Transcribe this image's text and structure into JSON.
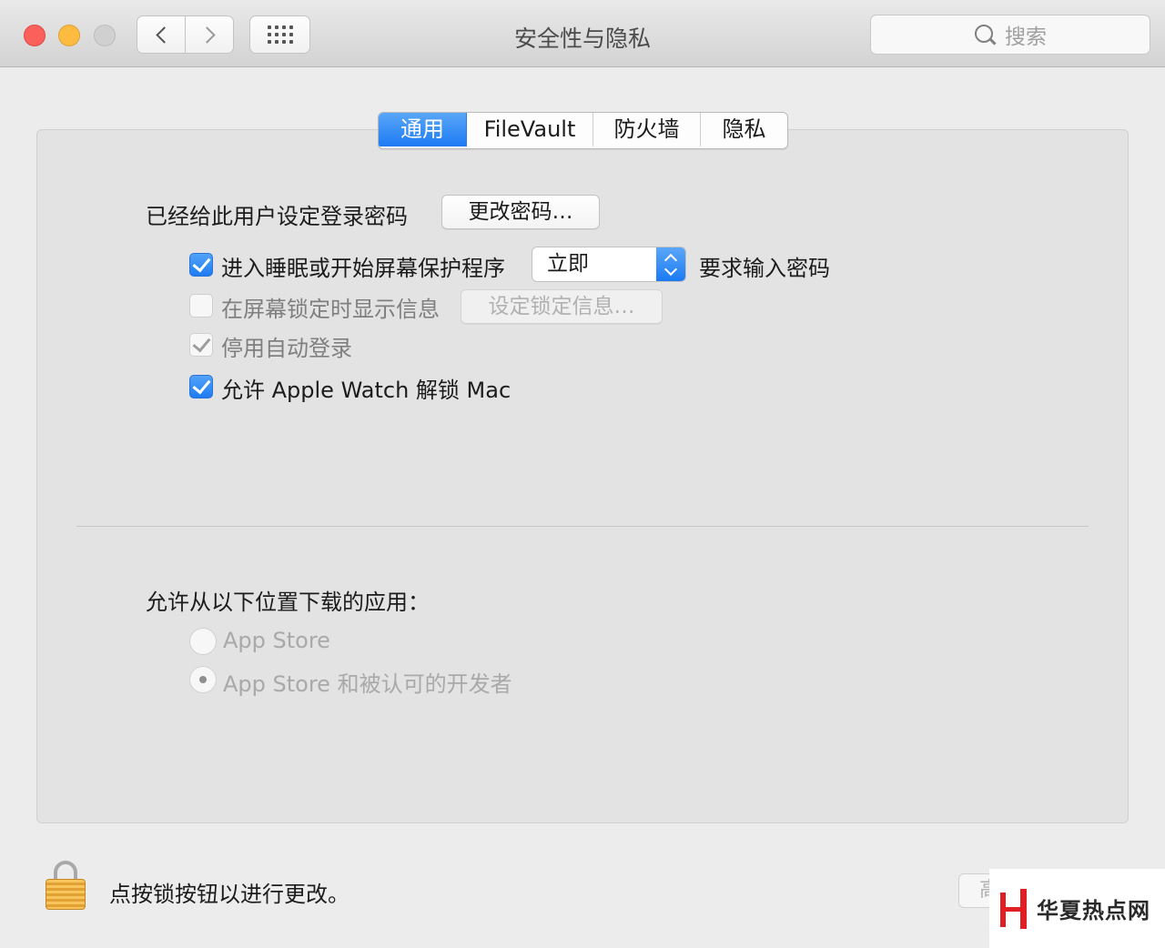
{
  "window": {
    "title": "安全性与隐私"
  },
  "toolbar": {
    "search_placeholder": "搜索"
  },
  "tabs": [
    {
      "label": "通用",
      "active": true
    },
    {
      "label": "FileVault",
      "active": false
    },
    {
      "label": "防火墙",
      "active": false
    },
    {
      "label": "隐私",
      "active": false
    }
  ],
  "general": {
    "password_label": "已经给此用户设定登录密码",
    "change_password_button": "更改密码…",
    "require_password": {
      "checked": true,
      "label": "进入睡眠或开始屏幕保护程序",
      "delay_value": "立即",
      "suffix": "要求输入密码"
    },
    "lock_message": {
      "checked": false,
      "enabled": false,
      "label": "在屏幕锁定时显示信息",
      "button": "设定锁定信息…"
    },
    "disable_auto_login": {
      "checked": true,
      "enabled": false,
      "label": "停用自动登录"
    },
    "apple_watch_unlock": {
      "checked": true,
      "label": "允许 Apple Watch 解锁 Mac"
    }
  },
  "downloads": {
    "heading": "允许从以下位置下载的应用：",
    "options": [
      {
        "label": "App Store",
        "selected": false
      },
      {
        "label": "App Store 和被认可的开发者",
        "selected": true
      }
    ]
  },
  "footer": {
    "lock_text": "点按锁按钮以进行更改。",
    "advanced_button": "高级…"
  },
  "watermark": {
    "text": "华夏热点网"
  },
  "colors": {
    "accent": "#1c7af3",
    "close": "#fc605b",
    "minimize": "#fdbc40",
    "zoom_disabled": "#d0d0d0",
    "watermark_red": "#e01e24"
  },
  "icons": [
    "chevron-left-icon",
    "chevron-right-icon",
    "grid-icon",
    "search-icon",
    "lock-icon",
    "checkmark-icon",
    "popup-arrows-icon"
  ]
}
